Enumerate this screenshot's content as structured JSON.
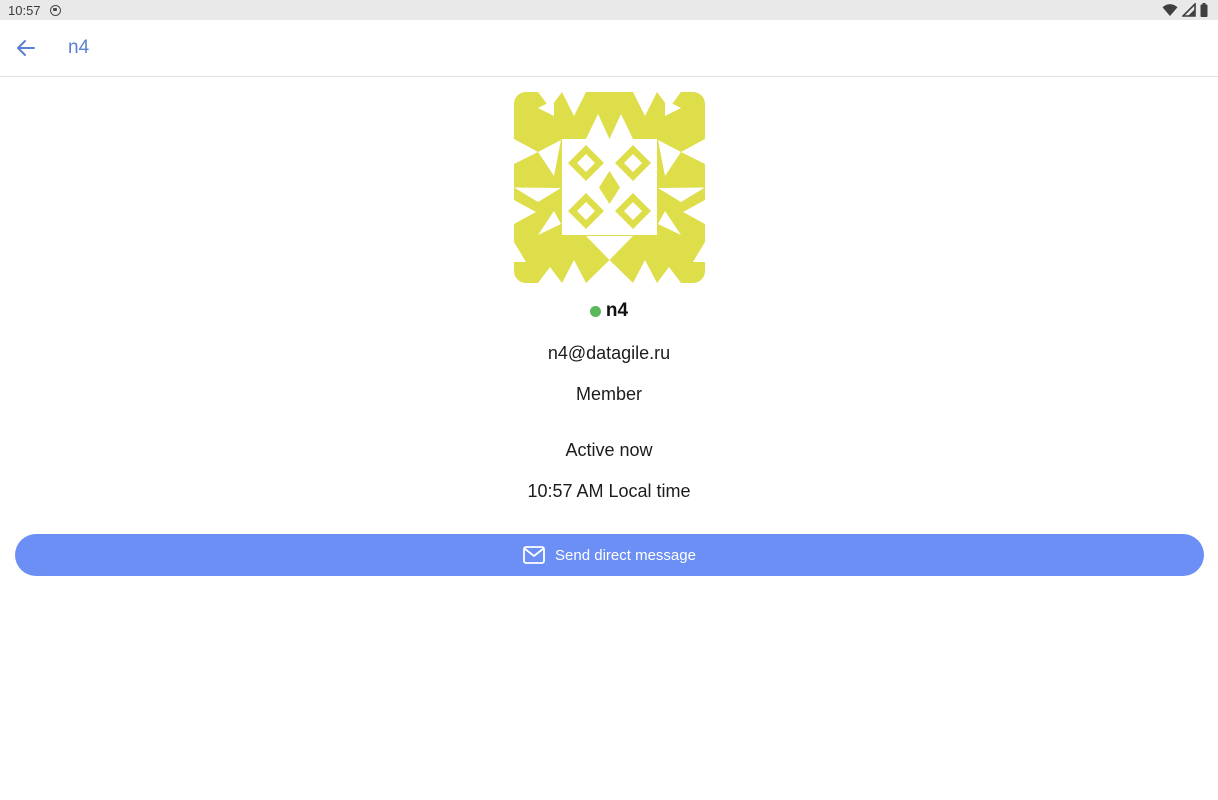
{
  "status_bar": {
    "time": "10:57",
    "app_icon": "notification-app-icon",
    "icons": [
      "wifi-icon",
      "signal-icon",
      "battery-icon"
    ]
  },
  "app_bar": {
    "back_icon": "arrow-left-icon",
    "title": "n4"
  },
  "profile": {
    "avatar_icon": "identicon-avatar",
    "avatar_color": "#dedd4a",
    "presence_color": "#5cb85c",
    "name": "n4",
    "email": "n4@datagile.ru",
    "role": "Member",
    "status": "Active now",
    "local_time": "10:57 AM Local time"
  },
  "actions": {
    "dm_icon": "mail-icon",
    "dm_label": "Send direct message",
    "dm_color": "#6b8ff5"
  },
  "colors": {
    "accent": "#5b7fd1",
    "status_bar_bg": "#e9e9e9"
  }
}
